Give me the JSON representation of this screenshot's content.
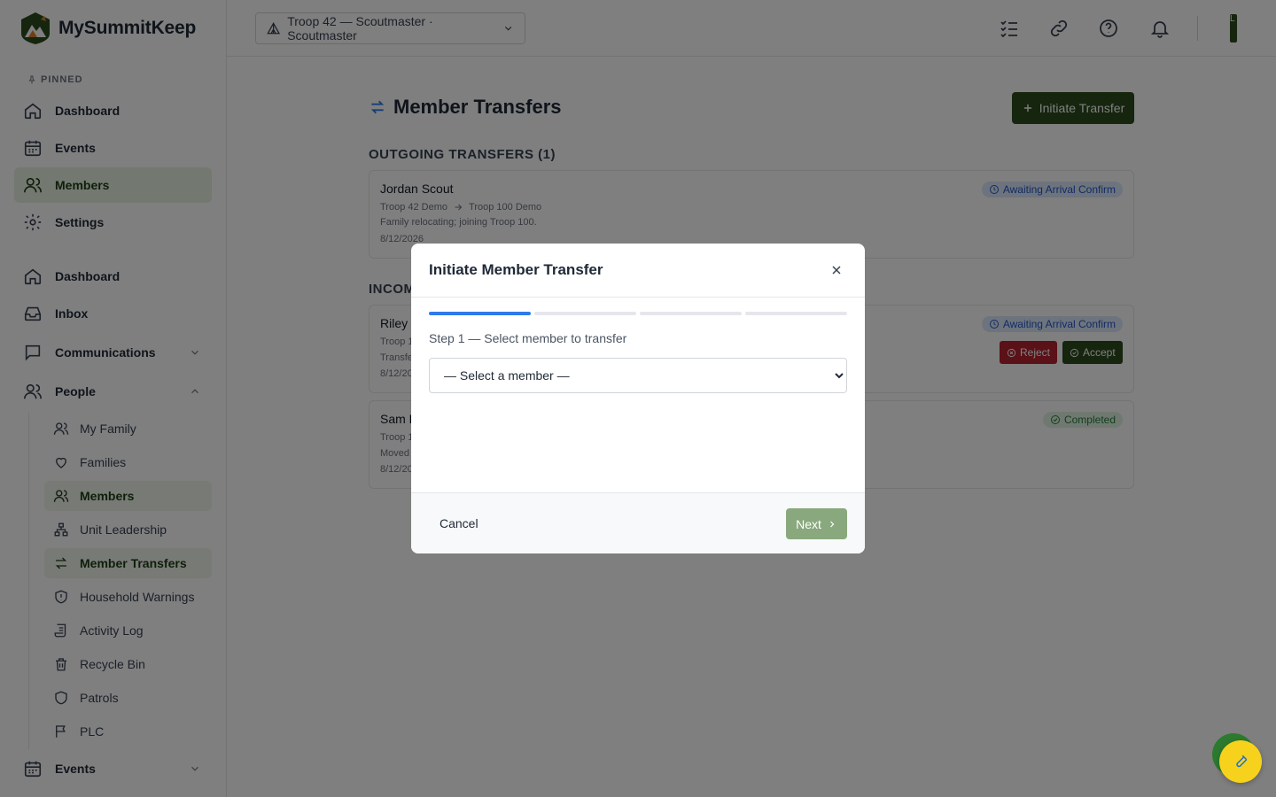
{
  "app": {
    "name": "MySummitKeep"
  },
  "sidebar": {
    "pinned_label": "PINNED",
    "pinned": [
      {
        "label": "Dashboard"
      },
      {
        "label": "Events"
      },
      {
        "label": "Members"
      },
      {
        "label": "Settings"
      }
    ],
    "nav": [
      {
        "label": "Dashboard"
      },
      {
        "label": "Inbox"
      },
      {
        "label": "Communications"
      },
      {
        "label": "People"
      }
    ],
    "people_items": [
      {
        "label": "My Family"
      },
      {
        "label": "Families"
      },
      {
        "label": "Members"
      },
      {
        "label": "Unit Leadership"
      },
      {
        "label": "Member Transfers"
      },
      {
        "label": "Household Warnings"
      },
      {
        "label": "Activity Log"
      },
      {
        "label": "Recycle Bin"
      },
      {
        "label": "Patrols"
      },
      {
        "label": "PLC"
      }
    ],
    "events_group": {
      "label": "Events"
    }
  },
  "topbar": {
    "unit_select": "Troop 42 — Scoutmaster · Scoutmaster",
    "avatar_initial": "L"
  },
  "page": {
    "title": "Member Transfers",
    "initiate_button": "Initiate Transfer",
    "outgoing_title": "OUTGOING TRANSFERS (1)",
    "incoming_title": "INCOM",
    "outgoing": [
      {
        "name": "Jordan Scout",
        "from": "Troop 42 Demo",
        "to": "Troop 100 Demo",
        "note": "Family relocating; joining Troop 100.",
        "date": "8/12/2026",
        "status": "Awaiting Arrival Confirm"
      }
    ],
    "incoming": [
      {
        "name": "Riley S",
        "line1": "Troop 1",
        "line2": "Transfe",
        "date": "8/12/20",
        "status": "Awaiting Arrival Confirm",
        "reject": "Reject",
        "accept": "Accept"
      },
      {
        "name": "Sam F",
        "line1": "Troop 1",
        "line2": "Moved",
        "date": "8/12/20",
        "status": "Completed"
      }
    ]
  },
  "modal": {
    "title": "Initiate Member Transfer",
    "step_label": "Step 1 — Select member to transfer",
    "select_value": "— Select a member —",
    "cancel": "Cancel",
    "next": "Next",
    "steps_total": 4,
    "steps_done": 1
  },
  "colors": {
    "brand": "#2c4a1d",
    "active_bg": "#e6f0e1",
    "progress": "#2f7bea",
    "next_disabled": "#8aa87d"
  }
}
